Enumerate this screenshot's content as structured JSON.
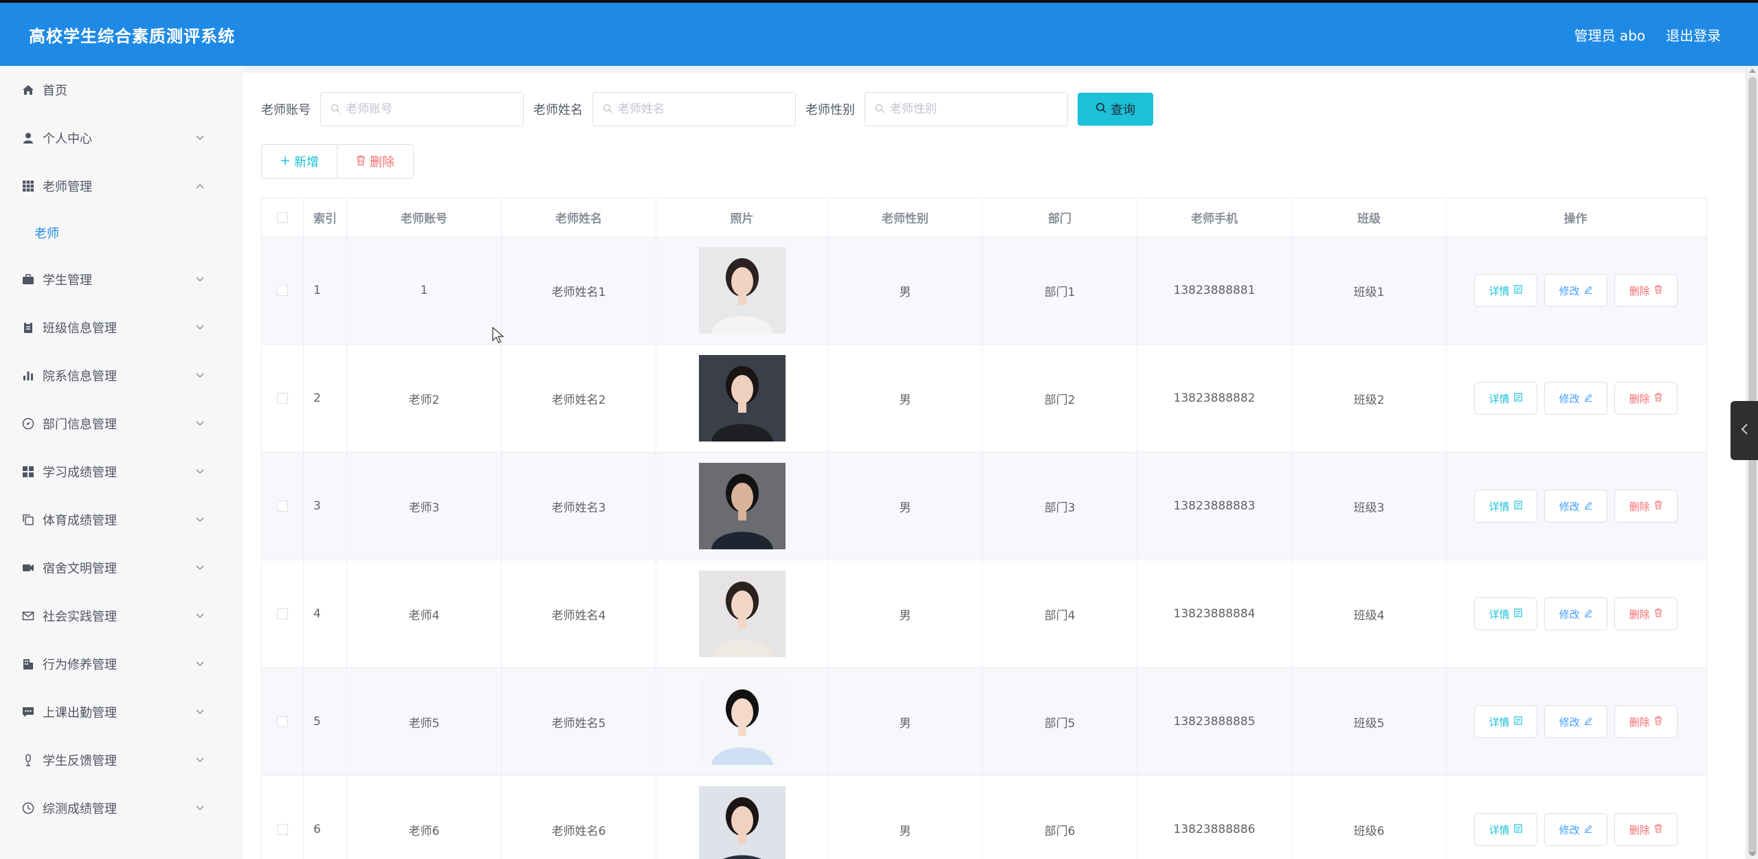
{
  "header": {
    "title": "高校学生综合素质测评系统",
    "user": "管理员 abo",
    "logout": "退出登录"
  },
  "sidebar": {
    "items": [
      {
        "label": "首页",
        "icon": "home-icon",
        "expandable": false
      },
      {
        "label": "个人中心",
        "icon": "user-icon",
        "expandable": true
      },
      {
        "label": "老师管理",
        "icon": "grid-icon",
        "expandable": true,
        "expanded": true,
        "children": [
          {
            "label": "老师"
          }
        ]
      },
      {
        "label": "学生管理",
        "icon": "briefcase-icon",
        "expandable": true
      },
      {
        "label": "班级信息管理",
        "icon": "clipboard-icon",
        "expandable": true
      },
      {
        "label": "院系信息管理",
        "icon": "bar-chart-icon",
        "expandable": true
      },
      {
        "label": "部门信息管理",
        "icon": "compass-icon",
        "expandable": true
      },
      {
        "label": "学习成绩管理",
        "icon": "apps-icon",
        "expandable": true
      },
      {
        "label": "体育成绩管理",
        "icon": "copy-icon",
        "expandable": true
      },
      {
        "label": "宿舍文明管理",
        "icon": "video-icon",
        "expandable": true
      },
      {
        "label": "社会实践管理",
        "icon": "mail-icon",
        "expandable": true
      },
      {
        "label": "行为修养管理",
        "icon": "building-icon",
        "expandable": true
      },
      {
        "label": "上课出勤管理",
        "icon": "chat-icon",
        "expandable": true
      },
      {
        "label": "学生反馈管理",
        "icon": "microphone-icon",
        "expandable": true
      },
      {
        "label": "综测成绩管理",
        "icon": "clock-icon",
        "expandable": true
      }
    ]
  },
  "search": {
    "fields": [
      {
        "label": "老师账号",
        "placeholder": "老师账号"
      },
      {
        "label": "老师姓名",
        "placeholder": "老师姓名"
      },
      {
        "label": "老师性别",
        "placeholder": "老师性别"
      }
    ],
    "query_label": "查询"
  },
  "actions": {
    "add_label": "新增",
    "delete_label": "删除"
  },
  "table": {
    "headers": {
      "index": "索引",
      "account": "老师账号",
      "name": "老师姓名",
      "photo": "照片",
      "gender": "老师性别",
      "dept": "部门",
      "phone": "老师手机",
      "class": "班级",
      "ops": "操作"
    },
    "op_labels": {
      "detail": "详情",
      "edit": "修改",
      "delete": "删除"
    },
    "rows": [
      {
        "index": "1",
        "account": "1",
        "name": "老师姓名1",
        "gender": "男",
        "dept": "部门1",
        "phone": "13823888881",
        "class": "班级1"
      },
      {
        "index": "2",
        "account": "老师2",
        "name": "老师姓名2",
        "gender": "男",
        "dept": "部门2",
        "phone": "13823888882",
        "class": "班级2"
      },
      {
        "index": "3",
        "account": "老师3",
        "name": "老师姓名3",
        "gender": "男",
        "dept": "部门3",
        "phone": "13823888883",
        "class": "班级3"
      },
      {
        "index": "4",
        "account": "老师4",
        "name": "老师姓名4",
        "gender": "男",
        "dept": "部门4",
        "phone": "13823888884",
        "class": "班级4"
      },
      {
        "index": "5",
        "account": "老师5",
        "name": "老师姓名5",
        "gender": "男",
        "dept": "部门5",
        "phone": "13823888885",
        "class": "班级5"
      },
      {
        "index": "6",
        "account": "老师6",
        "name": "老师姓名6",
        "gender": "男",
        "dept": "部门6",
        "phone": "13823888886",
        "class": "班级6"
      }
    ]
  },
  "colors": {
    "header_bg": "#1f8ae6",
    "accent_cyan": "#1cc0d8",
    "accent_blue": "#409eff",
    "danger": "#f56c6c"
  }
}
